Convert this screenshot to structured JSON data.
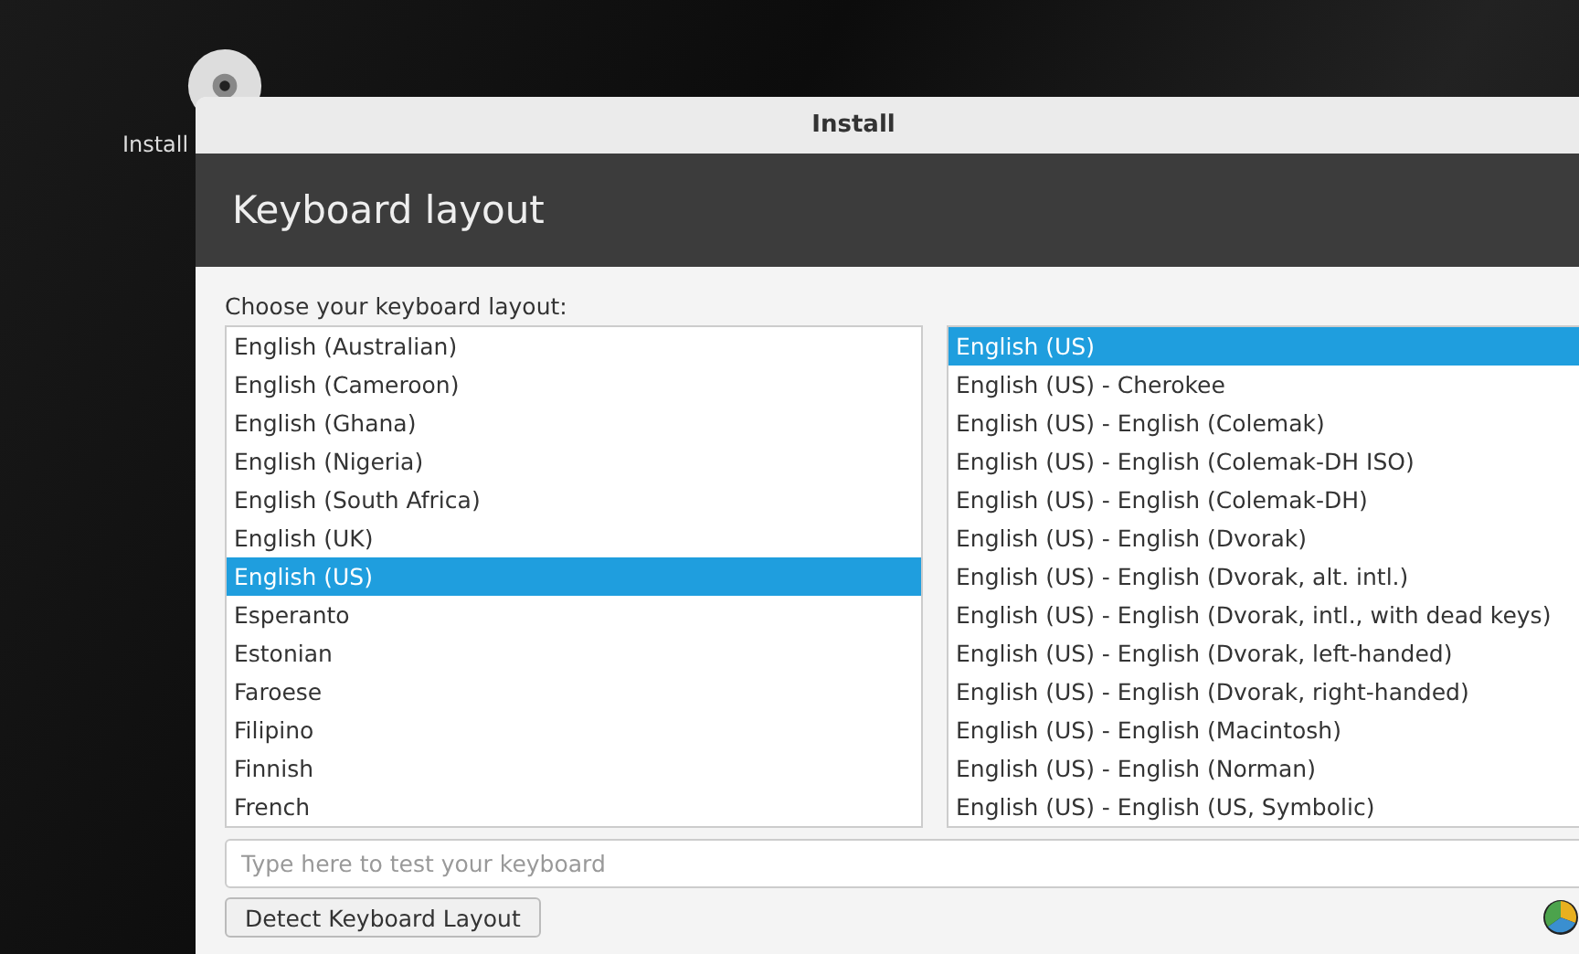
{
  "desktop": {
    "icon_label": "Install"
  },
  "window": {
    "title": "Install"
  },
  "header": {
    "title": "Keyboard layout"
  },
  "prompt": "Choose your keyboard layout:",
  "layouts": [
    {
      "label": "English (Australian)",
      "selected": false
    },
    {
      "label": "English (Cameroon)",
      "selected": false
    },
    {
      "label": "English (Ghana)",
      "selected": false
    },
    {
      "label": "English (Nigeria)",
      "selected": false
    },
    {
      "label": "English (South Africa)",
      "selected": false
    },
    {
      "label": "English (UK)",
      "selected": false
    },
    {
      "label": "English (US)",
      "selected": true
    },
    {
      "label": "Esperanto",
      "selected": false
    },
    {
      "label": "Estonian",
      "selected": false
    },
    {
      "label": "Faroese",
      "selected": false
    },
    {
      "label": "Filipino",
      "selected": false
    },
    {
      "label": "Finnish",
      "selected": false
    },
    {
      "label": "French",
      "selected": false
    }
  ],
  "variants": [
    {
      "label": "English (US)",
      "selected": true
    },
    {
      "label": "English (US) - Cherokee",
      "selected": false
    },
    {
      "label": "English (US) - English (Colemak)",
      "selected": false
    },
    {
      "label": "English (US) - English (Colemak-DH ISO)",
      "selected": false
    },
    {
      "label": "English (US) - English (Colemak-DH)",
      "selected": false
    },
    {
      "label": "English (US) - English (Dvorak)",
      "selected": false
    },
    {
      "label": "English (US) - English (Dvorak, alt. intl.)",
      "selected": false
    },
    {
      "label": "English (US) - English (Dvorak, intl., with dead keys)",
      "selected": false
    },
    {
      "label": "English (US) - English (Dvorak, left-handed)",
      "selected": false
    },
    {
      "label": "English (US) - English (Dvorak, right-handed)",
      "selected": false
    },
    {
      "label": "English (US) - English (Macintosh)",
      "selected": false
    },
    {
      "label": "English (US) - English (Norman)",
      "selected": false
    },
    {
      "label": "English (US) - English (US, Symbolic)",
      "selected": false
    }
  ],
  "test_field": {
    "placeholder": "Type here to test your keyboard"
  },
  "detect_button": "Detect Keyboard Layout"
}
